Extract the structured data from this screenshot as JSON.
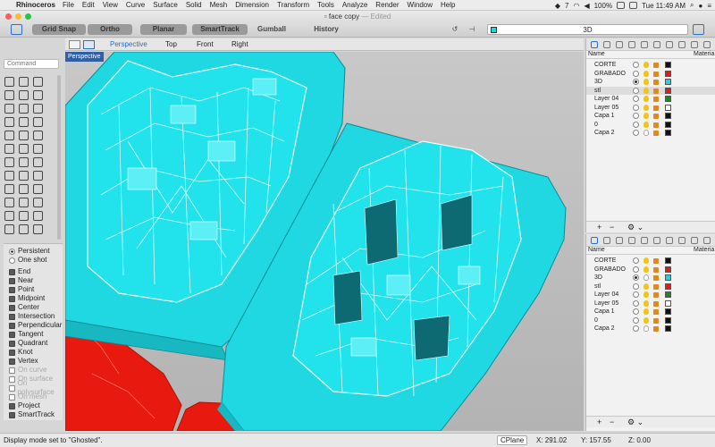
{
  "menubar": {
    "app": "Rhinoceros",
    "items": [
      "File",
      "Edit",
      "View",
      "Curve",
      "Surface",
      "Solid",
      "Mesh",
      "Dimension",
      "Transform",
      "Tools",
      "Analyze",
      "Render",
      "Window",
      "Help"
    ],
    "status_count": "7",
    "battery": "100%",
    "clock": "Tue 11:49 AM"
  },
  "window": {
    "title": "face copy",
    "edited": "— Edited"
  },
  "toolbar": {
    "grid_snap": "Grid Snap",
    "ortho": "Ortho",
    "planar": "Planar",
    "smarttrack": "SmartTrack",
    "gumball": "Gumball",
    "history": "History",
    "current_layer": "3D",
    "current_layer_color": "#19d6e0"
  },
  "viewport_tabs": {
    "items": [
      "Perspective",
      "Top",
      "Front",
      "Right"
    ],
    "active": "Perspective"
  },
  "viewport": {
    "label": "Perspective",
    "mesh_color": "#19d6e0",
    "other_color": "#e81a10"
  },
  "command": {
    "placeholder": "Command"
  },
  "snaps": {
    "modes": [
      {
        "label": "Persistent",
        "on": true
      },
      {
        "label": "One shot",
        "on": false
      }
    ],
    "items": [
      {
        "label": "End",
        "on": true
      },
      {
        "label": "Near",
        "on": true
      },
      {
        "label": "Point",
        "on": true
      },
      {
        "label": "Midpoint",
        "on": true
      },
      {
        "label": "Center",
        "on": true
      },
      {
        "label": "Intersection",
        "on": true
      },
      {
        "label": "Perpendicular",
        "on": true
      },
      {
        "label": "Tangent",
        "on": true
      },
      {
        "label": "Quadrant",
        "on": true
      },
      {
        "label": "Knot",
        "on": true
      },
      {
        "label": "Vertex",
        "on": true
      },
      {
        "label": "On curve",
        "on": false
      },
      {
        "label": "On surface",
        "on": false
      },
      {
        "label": "On polysurface",
        "on": false
      },
      {
        "label": "On mesh",
        "on": false
      },
      {
        "label": "Project",
        "on": true
      },
      {
        "label": "SmartTrack",
        "on": true
      }
    ]
  },
  "layers_top": {
    "col_name": "Name",
    "col_material": "Materia",
    "rows": [
      {
        "name": "CORTE",
        "color": "#111111",
        "current": false,
        "on": true,
        "selected": false
      },
      {
        "name": "GRABADO",
        "color": "#e81a10",
        "current": false,
        "on": true,
        "selected": false
      },
      {
        "name": "3D",
        "color": "#19d6e0",
        "current": true,
        "on": true,
        "selected": false
      },
      {
        "name": "stl",
        "color": "#e81a10",
        "current": false,
        "on": true,
        "selected": true
      },
      {
        "name": "Layer 04",
        "color": "#1a8a1a",
        "current": false,
        "on": true,
        "selected": false
      },
      {
        "name": "Layer 05",
        "color": "#ffffff",
        "current": false,
        "on": true,
        "selected": false
      },
      {
        "name": "Capa 1",
        "color": "#111111",
        "current": false,
        "on": true,
        "selected": false
      },
      {
        "name": "0",
        "color": "#111111",
        "current": false,
        "on": true,
        "selected": false
      },
      {
        "name": "Capa 2",
        "color": "#111111",
        "current": false,
        "on": false,
        "selected": false
      }
    ],
    "footer": {
      "add": "+",
      "remove": "−",
      "gear": "⚙ ⌄"
    }
  },
  "layers_bottom": {
    "col_name": "Name",
    "col_material": "Materia",
    "rows": [
      {
        "name": "CORTE",
        "color": "#111111",
        "current": false,
        "on": true,
        "selected": false
      },
      {
        "name": "GRABADO",
        "color": "#e81a10",
        "current": false,
        "on": true,
        "selected": false
      },
      {
        "name": "3D",
        "color": "#19d6e0",
        "current": true,
        "on": false,
        "selected": false
      },
      {
        "name": "stl",
        "color": "#e81a10",
        "current": false,
        "on": true,
        "selected": false
      },
      {
        "name": "Layer 04",
        "color": "#1a8a1a",
        "current": false,
        "on": true,
        "selected": false
      },
      {
        "name": "Layer 05",
        "color": "#ffffff",
        "current": false,
        "on": true,
        "selected": false
      },
      {
        "name": "Capa 1",
        "color": "#111111",
        "current": false,
        "on": true,
        "selected": false
      },
      {
        "name": "0",
        "color": "#111111",
        "current": false,
        "on": true,
        "selected": false
      },
      {
        "name": "Capa 2",
        "color": "#111111",
        "current": false,
        "on": false,
        "selected": false
      }
    ],
    "footer": {
      "add": "+",
      "remove": "−",
      "gear": "⚙ ⌄"
    }
  },
  "statusbar": {
    "message": "Display mode set to \"Ghosted\".",
    "cplane": "CPlane",
    "x": "X: 291.02",
    "y": "Y: 157.55",
    "z": "Z: 0.00"
  }
}
